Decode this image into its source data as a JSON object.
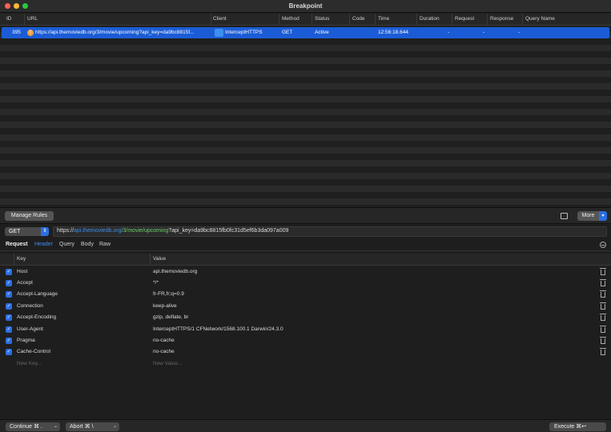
{
  "window": {
    "title": "Breakpoint"
  },
  "table": {
    "columns": [
      "ID",
      "URL",
      "Client",
      "Method",
      "Status",
      "Code",
      "Time",
      "Duration",
      "Request",
      "Response",
      "Query Name"
    ],
    "rows": [
      {
        "id": "395",
        "url": "https://api.themoviedb.org/3/movie/upcoming?api_key=da9bc8815f...",
        "client": "InterceptHTTPS",
        "method": "GET",
        "status": "Active",
        "code": "",
        "time": "12:56:18.644",
        "duration": "-",
        "request": "-",
        "response": "-",
        "query_name": ""
      }
    ]
  },
  "toolbar": {
    "manage_rules": "Manage Rules",
    "more": "More"
  },
  "urlbar": {
    "method": "GET",
    "url_scheme": "https://",
    "url_host": "api.themoviedb.org",
    "url_path": "/3/movie/upcoming",
    "url_query": "?api_key=da9bc8815fb0fc31d5ef6b3da097a009"
  },
  "request_tabs": {
    "section": "Request",
    "tabs": [
      "Header",
      "Query",
      "Body",
      "Raw"
    ],
    "active": "Header"
  },
  "headers_table": {
    "key_col": "Key",
    "value_col": "Value",
    "rows": [
      {
        "key": "Host",
        "value": "api.themoviedb.org"
      },
      {
        "key": "Accept",
        "value": "*/*"
      },
      {
        "key": "Accept-Language",
        "value": "fr-FR,fr;q=0.9"
      },
      {
        "key": "Connection",
        "value": "keep-alive"
      },
      {
        "key": "Accept-Encoding",
        "value": "gzip, deflate, br"
      },
      {
        "key": "User-Agent",
        "value": "InterceptHTTPS/1 CFNetwork/1568.100.1 Darwin/24.3.0"
      },
      {
        "key": "Pragma",
        "value": "no-cache"
      },
      {
        "key": "Cache-Control",
        "value": "no-cache"
      }
    ],
    "new_key_placeholder": "New Key...",
    "new_value_placeholder": "New Value..."
  },
  "bottombar": {
    "continue": "Continue ⌘ .",
    "abort": "Abort ⌘ \\",
    "execute": "Execute ⌘↩"
  }
}
